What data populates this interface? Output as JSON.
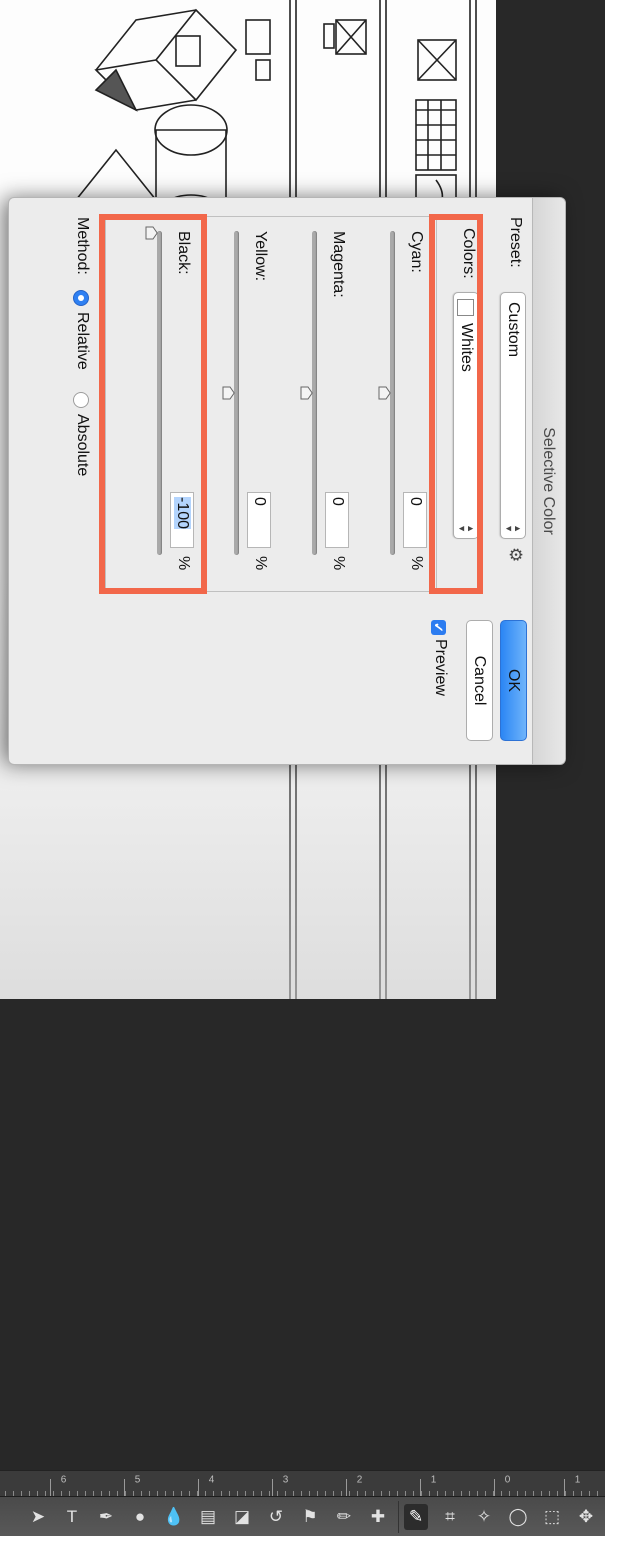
{
  "dialog": {
    "title": "Selective Color",
    "preset_label": "Preset:",
    "preset_value": "Custom",
    "ok_label": "OK",
    "cancel_label": "Cancel",
    "preview_label": "Preview",
    "preview_checked": true,
    "colors_label": "Colors:",
    "colors_value": "Whites",
    "sliders": [
      {
        "name": "Cyan",
        "label": "Cyan:",
        "value": "0",
        "unit": "%"
      },
      {
        "name": "Magenta",
        "label": "Magenta:",
        "value": "0",
        "unit": "%"
      },
      {
        "name": "Yellow",
        "label": "Yellow:",
        "value": "0",
        "unit": "%"
      },
      {
        "name": "Black",
        "label": "Black:",
        "value": "-100",
        "unit": "%"
      }
    ],
    "method_label": "Method:",
    "method_options": [
      "Relative",
      "Absolute"
    ],
    "method_selected": "Relative"
  },
  "ruler": {
    "numbers": [
      "1",
      "0",
      "1",
      "2",
      "3",
      "4",
      "5",
      "6"
    ]
  },
  "colors": {
    "highlight": "#f2674a",
    "ok_button": "#2b86f4",
    "workspace": "#282828"
  }
}
